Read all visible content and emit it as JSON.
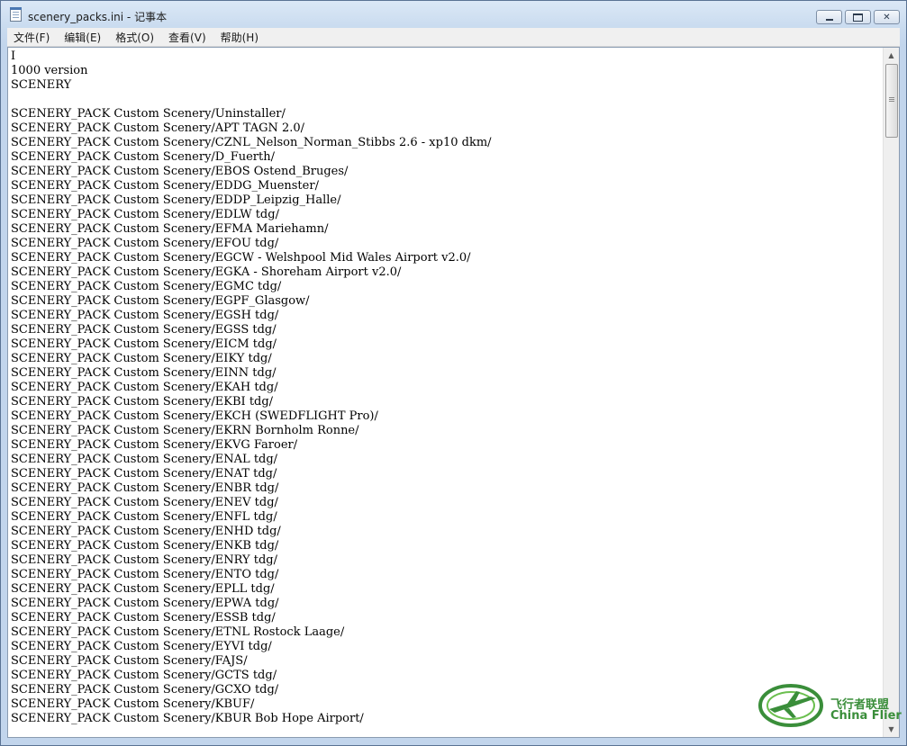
{
  "window": {
    "title": "scenery_packs.ini - 记事本",
    "caption_buttons": [
      "minimize",
      "maximize",
      "close"
    ]
  },
  "menu": [
    {
      "label": "文件(F)"
    },
    {
      "label": "编辑(E)"
    },
    {
      "label": "格式(O)"
    },
    {
      "label": "查看(V)"
    },
    {
      "label": "帮助(H)"
    }
  ],
  "editor": {
    "lines": [
      "I",
      "1000 version",
      "SCENERY",
      "",
      "SCENERY_PACK Custom Scenery/Uninstaller/",
      "SCENERY_PACK Custom Scenery/APT TAGN 2.0/",
      "SCENERY_PACK Custom Scenery/CZNL_Nelson_Norman_Stibbs 2.6 - xp10 dkm/",
      "SCENERY_PACK Custom Scenery/D_Fuerth/",
      "SCENERY_PACK Custom Scenery/EBOS Ostend_Bruges/",
      "SCENERY_PACK Custom Scenery/EDDG_Muenster/",
      "SCENERY_PACK Custom Scenery/EDDP_Leipzig_Halle/",
      "SCENERY_PACK Custom Scenery/EDLW tdg/",
      "SCENERY_PACK Custom Scenery/EFMA Mariehamn/",
      "SCENERY_PACK Custom Scenery/EFOU tdg/",
      "SCENERY_PACK Custom Scenery/EGCW - Welshpool Mid Wales Airport v2.0/",
      "SCENERY_PACK Custom Scenery/EGKA - Shoreham Airport v2.0/",
      "SCENERY_PACK Custom Scenery/EGMC tdg/",
      "SCENERY_PACK Custom Scenery/EGPF_Glasgow/",
      "SCENERY_PACK Custom Scenery/EGSH tdg/",
      "SCENERY_PACK Custom Scenery/EGSS tdg/",
      "SCENERY_PACK Custom Scenery/EICM tdg/",
      "SCENERY_PACK Custom Scenery/EIKY tdg/",
      "SCENERY_PACK Custom Scenery/EINN tdg/",
      "SCENERY_PACK Custom Scenery/EKAH tdg/",
      "SCENERY_PACK Custom Scenery/EKBI tdg/",
      "SCENERY_PACK Custom Scenery/EKCH (SWEDFLIGHT Pro)/",
      "SCENERY_PACK Custom Scenery/EKRN Bornholm Ronne/",
      "SCENERY_PACK Custom Scenery/EKVG Faroer/",
      "SCENERY_PACK Custom Scenery/ENAL tdg/",
      "SCENERY_PACK Custom Scenery/ENAT tdg/",
      "SCENERY_PACK Custom Scenery/ENBR tdg/",
      "SCENERY_PACK Custom Scenery/ENEV tdg/",
      "SCENERY_PACK Custom Scenery/ENFL tdg/",
      "SCENERY_PACK Custom Scenery/ENHD tdg/",
      "SCENERY_PACK Custom Scenery/ENKB tdg/",
      "SCENERY_PACK Custom Scenery/ENRY tdg/",
      "SCENERY_PACK Custom Scenery/ENTO tdg/",
      "SCENERY_PACK Custom Scenery/EPLL tdg/",
      "SCENERY_PACK Custom Scenery/EPWA tdg/",
      "SCENERY_PACK Custom Scenery/ESSB tdg/",
      "SCENERY_PACK Custom Scenery/ETNL Rostock Laage/",
      "SCENERY_PACK Custom Scenery/EYVI tdg/",
      "SCENERY_PACK Custom Scenery/FAJS/",
      "SCENERY_PACK Custom Scenery/GCTS tdg/",
      "SCENERY_PACK Custom Scenery/GCXO tdg/",
      "SCENERY_PACK Custom Scenery/KBUF/",
      "SCENERY_PACK Custom Scenery/KBUR Bob Hope Airport/"
    ]
  },
  "watermark": {
    "text_cn": "飞行者联盟",
    "text_en": "China Flier",
    "color": "#3a8e3a"
  },
  "colors": {
    "titlebar": "#c9dbef",
    "menubar": "#f0f0f0",
    "editor_bg": "#ffffff"
  }
}
